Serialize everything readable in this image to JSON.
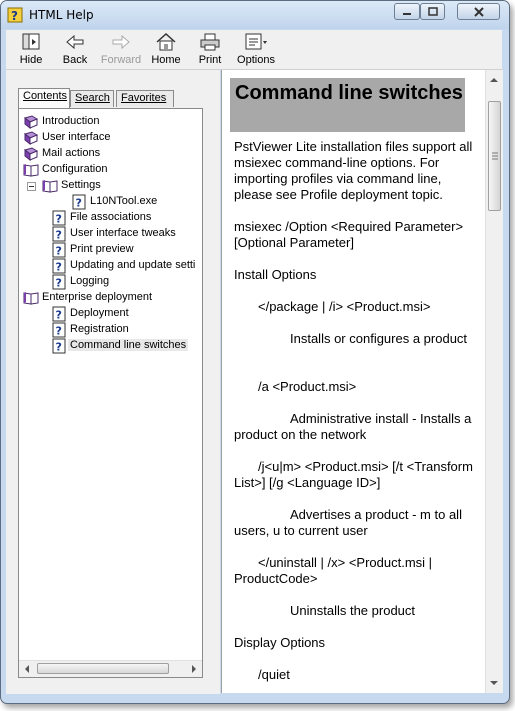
{
  "window": {
    "title": "HTML Help"
  },
  "toolbar": {
    "buttons": [
      {
        "label": "Hide",
        "icon": "hide-icon",
        "enabled": true
      },
      {
        "label": "Back",
        "icon": "back-arrow-icon",
        "enabled": true
      },
      {
        "label": "Forward",
        "icon": "forward-arrow-icon",
        "enabled": false
      },
      {
        "label": "Home",
        "icon": "home-icon",
        "enabled": true
      },
      {
        "label": "Print",
        "icon": "printer-icon",
        "enabled": true
      },
      {
        "label": "Options",
        "icon": "options-icon",
        "enabled": true
      }
    ]
  },
  "nav_tabs": [
    {
      "label": "Contents",
      "active": true
    },
    {
      "label": "Search",
      "active": false
    },
    {
      "label": "Favorites",
      "active": false
    }
  ],
  "tree": [
    {
      "label": "Introduction",
      "icon": "book-closed-icon"
    },
    {
      "label": "User interface",
      "icon": "book-closed-icon"
    },
    {
      "label": "Mail actions",
      "icon": "book-closed-icon"
    },
    {
      "label": "Configuration",
      "icon": "book-open-icon"
    },
    {
      "label": "Settings",
      "icon": "book-open-icon"
    },
    {
      "label": "L10NTool.exe",
      "icon": "help-page-icon"
    },
    {
      "label": "File associations",
      "icon": "help-page-icon"
    },
    {
      "label": "User interface tweaks",
      "icon": "help-page-icon"
    },
    {
      "label": "Print preview",
      "icon": "help-page-icon"
    },
    {
      "label": "Updating and update setti",
      "icon": "help-page-icon"
    },
    {
      "label": "Logging",
      "icon": "help-page-icon"
    },
    {
      "label": "Enterprise deployment",
      "icon": "book-open-icon"
    },
    {
      "label": "Deployment",
      "icon": "help-page-icon"
    },
    {
      "label": "Registration",
      "icon": "help-page-icon"
    },
    {
      "label": "Command line switches",
      "icon": "help-page-icon",
      "selected": true
    }
  ],
  "content": {
    "heading": "Command line switches",
    "paragraphs": [
      "PstViewer Lite installation files support all msiexec command-line options. For importing profiles via command line, please see Profile deployment topic.",
      "msiexec /Option <Required Parameter> [Optional Parameter]",
      "Install Options",
      "</package | /i> <Product.msi>",
      "Installs or configures a product",
      "/a <Product.msi>",
      "Administrative install - Installs a product on the network",
      "/j<u|m> <Product.msi> [/t <Transform List>] [/g <Language ID>]",
      "Advertises a product - m to all users, u to current user",
      "</uninstall | /x> <Product.msi | ProductCode>",
      "Uninstalls the product",
      "Display Options",
      "/quiet"
    ]
  }
}
